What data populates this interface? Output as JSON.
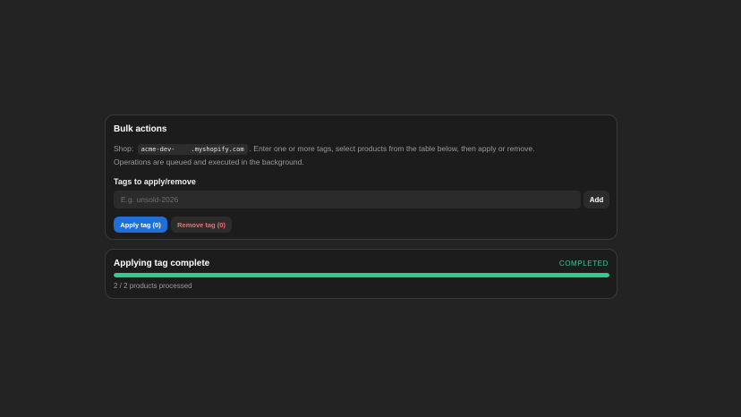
{
  "bulk_actions": {
    "title": "Bulk actions",
    "shop_prefix": "Shop:",
    "shop_domain_start": "acme-dev-",
    "shop_domain_end": ".myshopify.com",
    "description_line1": ". Enter one or more tags, select products from the table below, then apply or remove.",
    "description_line2": "Operations are queued and executed in the background.",
    "tags_label": "Tags to apply/remove",
    "tags_input": {
      "value": "",
      "placeholder": "E.g. unsold-2026"
    },
    "add_label": "Add",
    "apply_label": "Apply tag (0)",
    "remove_label": "Remove tag (0)"
  },
  "progress": {
    "title": "Applying tag complete",
    "status": "COMPLETED",
    "fraction": 1.0,
    "processed_text": "2 / 2 products processed"
  },
  "colors": {
    "background": "#232323",
    "card": "#1c1c1c",
    "primary_button": "#1f6fd8",
    "danger_text": "#e57373",
    "success": "#2ecc8f"
  }
}
